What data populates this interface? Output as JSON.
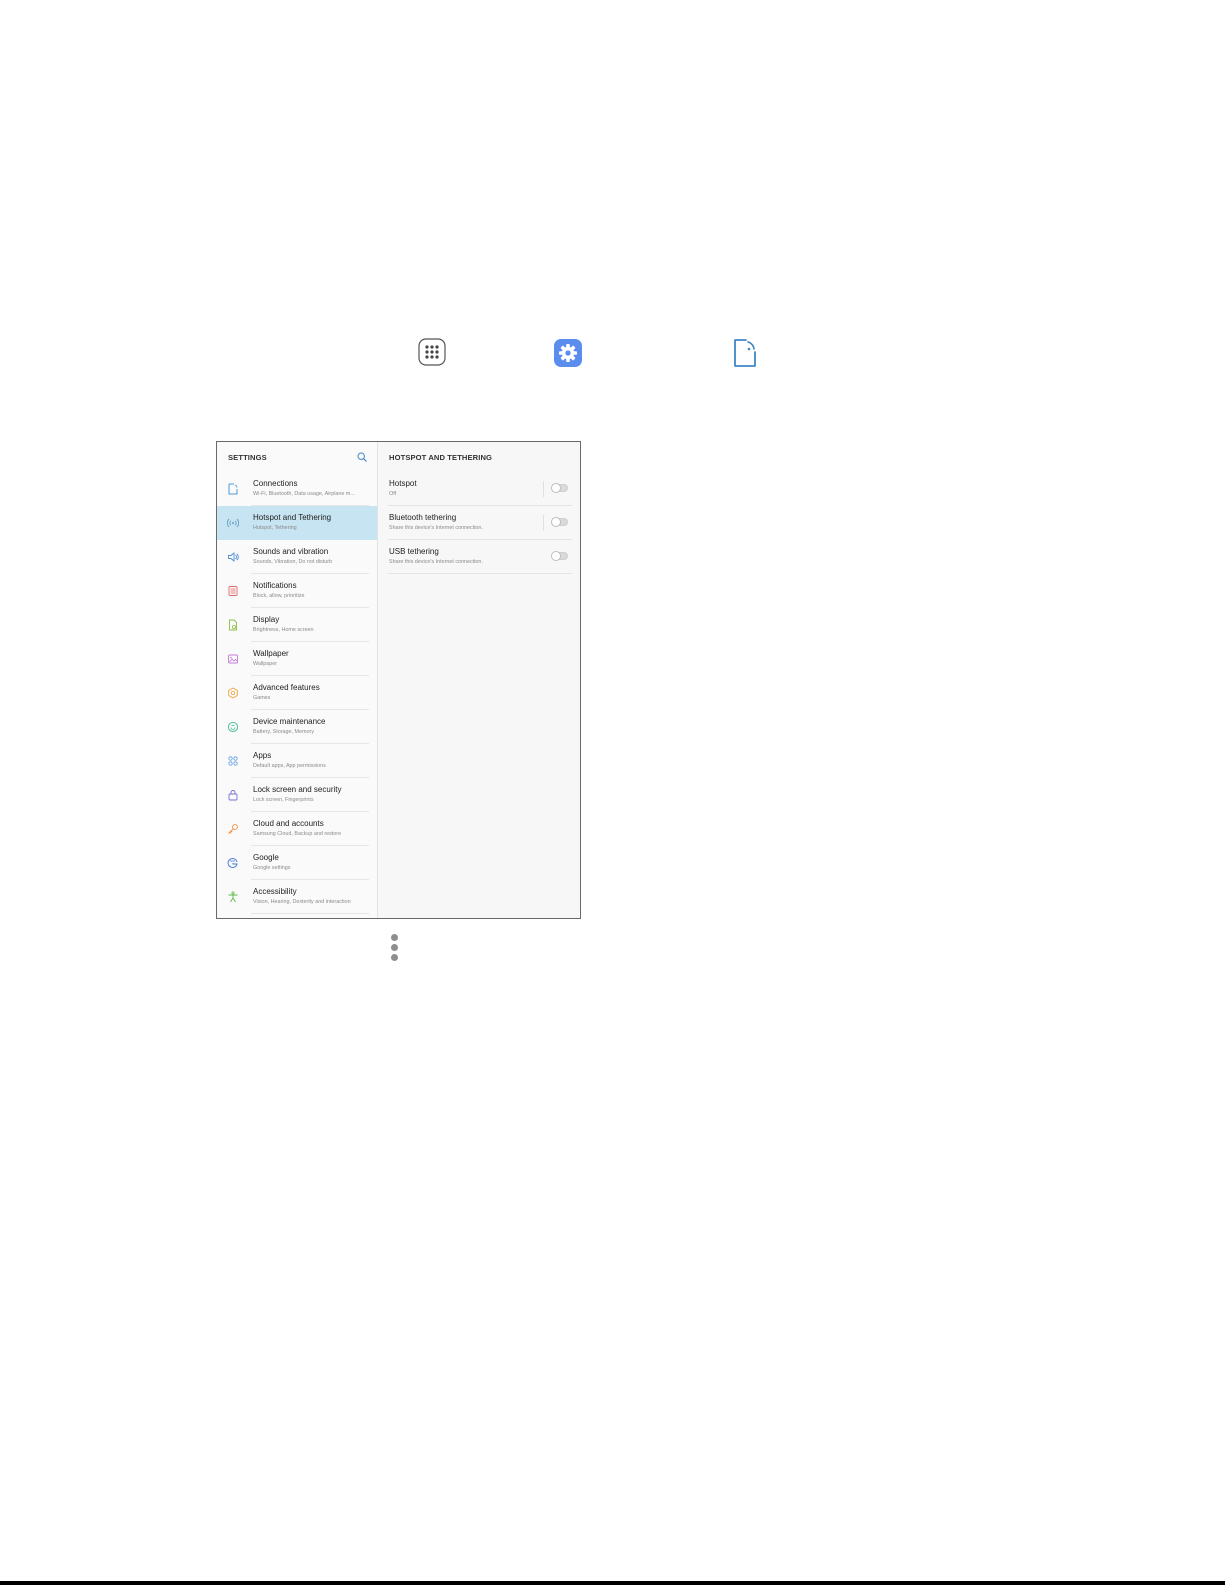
{
  "colors": {
    "gear_icon_bg": "#5b8def",
    "selected_row_bg": "#c6e4f1",
    "accent_blue": "#3f88c5"
  },
  "top_icons": [
    "apps-icon",
    "settings-gear-icon",
    "connections-icon"
  ],
  "left_pane": {
    "title": "SETTINGS",
    "search_icon": "search-icon",
    "items": [
      {
        "title": "Connections",
        "subtitle": "Wi-Fi, Bluetooth, Data usage, Airplane m...",
        "icon": "connections-icon",
        "icon_color": "#4f9bd6",
        "selected": false
      },
      {
        "title": "Hotspot and Tethering",
        "subtitle": "Hotspot, Tethering",
        "icon": "hotspot-icon",
        "icon_color": "#6a9fc7",
        "selected": true
      },
      {
        "title": "Sounds and vibration",
        "subtitle": "Sounds, Vibration, Do not disturb",
        "icon": "speaker-icon",
        "icon_color": "#4d8fd8",
        "selected": false
      },
      {
        "title": "Notifications",
        "subtitle": "Block, allow, prioritize",
        "icon": "notifications-icon",
        "icon_color": "#e26a6a",
        "selected": false
      },
      {
        "title": "Display",
        "subtitle": "Brightness, Home screen",
        "icon": "display-icon",
        "icon_color": "#8bbf45",
        "selected": false
      },
      {
        "title": "Wallpaper",
        "subtitle": "Wallpaper",
        "icon": "wallpaper-icon",
        "icon_color": "#c57bd6",
        "selected": false
      },
      {
        "title": "Advanced features",
        "subtitle": "Games",
        "icon": "advanced-features-icon",
        "icon_color": "#f0a33a",
        "selected": false
      },
      {
        "title": "Device maintenance",
        "subtitle": "Battery, Storage, Memory",
        "icon": "device-maintenance-icon",
        "icon_color": "#3dbb8e",
        "selected": false
      },
      {
        "title": "Apps",
        "subtitle": "Default apps, App permissions",
        "icon": "apps-grid-icon",
        "icon_color": "#5a9be0",
        "selected": false
      },
      {
        "title": "Lock screen and security",
        "subtitle": "Lock screen, Fingerprints",
        "icon": "lock-icon",
        "icon_color": "#7b6fd6",
        "selected": false
      },
      {
        "title": "Cloud and accounts",
        "subtitle": "Samsung Cloud, Backup and restore",
        "icon": "key-icon",
        "icon_color": "#f08a3a",
        "selected": false
      },
      {
        "title": "Google",
        "subtitle": "Google settings",
        "icon": "google-icon",
        "icon_color": "#4b7fd6",
        "selected": false
      },
      {
        "title": "Accessibility",
        "subtitle": "Vision, Hearing, Dexterity and interaction",
        "icon": "accessibility-icon",
        "icon_color": "#5fb84a",
        "selected": false
      }
    ]
  },
  "right_pane": {
    "title": "HOTSPOT AND TETHERING",
    "items": [
      {
        "title": "Hotspot",
        "subtitle": "Off",
        "toggle_on": false
      },
      {
        "title": "Bluetooth tethering",
        "subtitle": "Share this device's Internet connection.",
        "toggle_on": false
      },
      {
        "title": "USB tethering",
        "subtitle": "Share this device's Internet connection.",
        "toggle_on": false
      }
    ]
  },
  "more_options_icon": "more-options-icon"
}
